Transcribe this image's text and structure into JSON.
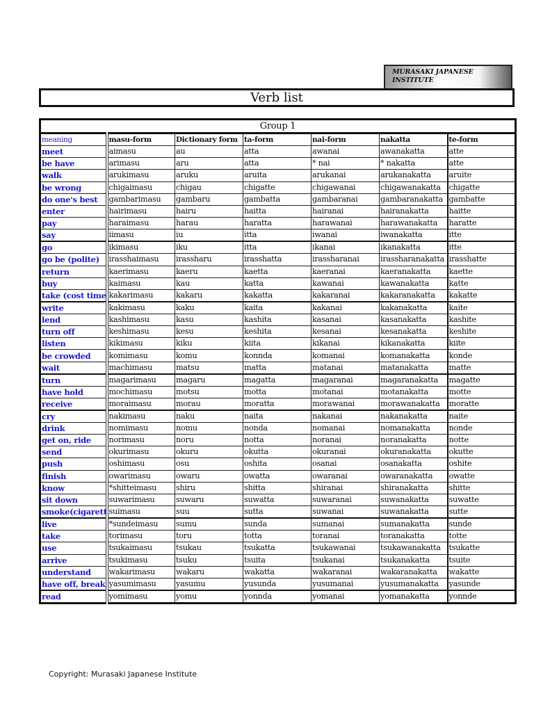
{
  "institute_box": {
    "line1": "MURASAKI JAPANESE",
    "line2": "INSTITUTE"
  },
  "title": "Verb list",
  "group_label": "Group 1",
  "columns": [
    "meaning",
    "masu-form",
    "Dictionary form",
    "ta-form",
    "nai-form",
    "nakatta",
    "te-form"
  ],
  "rows": [
    [
      "meet",
      "aimasu",
      "au",
      "atta",
      "awanai",
      "awanakatta",
      "atte"
    ],
    [
      "be have",
      "arimasu",
      "aru",
      "atta",
      "* nai",
      "* nakatta",
      "atte"
    ],
    [
      "walk",
      "arukimasu",
      "aruku",
      "aruita",
      "arukanai",
      "arukanakatta",
      "aruite"
    ],
    [
      "be wrong",
      "chigaimasu",
      "chigau",
      "chigatte",
      "chigawanai",
      "chigawanakatta",
      "chigatte"
    ],
    [
      "do one's best",
      "gambarimasu",
      "gambaru",
      "gambatta",
      "gambaranai",
      "gambaranakatta",
      "gambatte"
    ],
    [
      "enter",
      "hairimasu",
      "hairu",
      "haitta",
      "hairanai",
      "hairanakatta",
      "haitte"
    ],
    [
      "pay",
      "haraimasu",
      "harau",
      "haratta",
      "harawanai",
      "harawanakatta",
      "haratte"
    ],
    [
      "say",
      "iimasu",
      "iu",
      "itta",
      "iwanai",
      "iwanakatta",
      "itte"
    ],
    [
      "go",
      "ikimasu",
      "iku",
      "itta",
      "ikanai",
      "ikanakatta",
      "itte"
    ],
    [
      "go be (polite)",
      "irasshaimasu",
      "irassharu",
      "irasshatta",
      "irassharanai",
      "irassharanakatta",
      "irasshatte"
    ],
    [
      "return",
      "kaerimasu",
      "kaeru",
      "kaetta",
      "kaeranai",
      "kaeranakatta",
      "kaette"
    ],
    [
      "buy",
      "kaimasu",
      "kau",
      "katta",
      "kawanai",
      "kawanakatta",
      "katte"
    ],
    [
      "take (cost time)",
      "kakarimasu",
      "kakaru",
      "kakatta",
      "kakaranai",
      "kakaranakatta",
      "kakatte"
    ],
    [
      "write",
      "kakimasu",
      "kaku",
      "kaita",
      "kakanai",
      "kakanakatta",
      "kaite"
    ],
    [
      "lend",
      "kashimasu",
      "kasu",
      "kashita",
      "kasanai",
      "kasanakatta",
      "kashite"
    ],
    [
      "turn off",
      "keshimasu",
      "kesu",
      "keshita",
      "kesanai",
      "kesanakatta",
      "keshite"
    ],
    [
      "listen",
      "kikimasu",
      "kiku",
      "kiita",
      "kikanai",
      "kikanakatta",
      "kiite"
    ],
    [
      "be crowded",
      "komimasu",
      "komu",
      "konnda",
      "komanai",
      "komanakatta",
      "konde"
    ],
    [
      "wait",
      "machimasu",
      "matsu",
      "matta",
      "matanai",
      "matanakatta",
      "matte"
    ],
    [
      "turn",
      "magarimasu",
      "magaru",
      "magatta",
      "magaranai",
      "magaranakatta",
      "magatte"
    ],
    [
      "have hold",
      "mochimasu",
      "motsu",
      "motta",
      "motanai",
      "motanakatta",
      "motte"
    ],
    [
      "receive",
      "moraimasu",
      "morau",
      "moratta",
      "morawanai",
      "morawanakatta",
      "moratte"
    ],
    [
      "cry",
      "nakimasu",
      "naku",
      "naita",
      "nakanai",
      "nakanakatta",
      "naite"
    ],
    [
      "drink",
      "nomimasu",
      "nomu",
      "nonda",
      "nomanai",
      "nomanakatta",
      "nonde"
    ],
    [
      "get on, ride",
      "norimasu",
      "noru",
      "notta",
      "noranai",
      "noranakatta",
      "notte"
    ],
    [
      "send",
      "okurimasu",
      "okuru",
      "okutta",
      "okuranai",
      "okuranakatta",
      "okutte"
    ],
    [
      "push",
      "oshimasu",
      "osu",
      "oshita",
      "osanai",
      "osanakatta",
      "oshite"
    ],
    [
      "finish",
      "owarimasu",
      "owaru",
      "owatta",
      "owaranai",
      "owaranakatta",
      "owatte"
    ],
    [
      "know",
      "*shitteimasu",
      "shiru",
      "shitta",
      "shiranai",
      "shiranakatta",
      "shitte"
    ],
    [
      "sit down",
      "suwarimasu",
      "suwaru",
      "suwatta",
      "suwaranai",
      "suwanakatta",
      "suwatte"
    ],
    [
      "smoke(cigarette)",
      "suimasu",
      "suu",
      "sutta",
      "suwanai",
      "suwanakatta",
      "sutte"
    ],
    [
      "live",
      "*sundeimasu",
      "sumu",
      "sunda",
      "sumanai",
      "sumanakatta",
      "sunde"
    ],
    [
      "take",
      "torimasu",
      "toru",
      "totta",
      "toranai",
      "toranakatta",
      "totte"
    ],
    [
      "use",
      "tsukaimasu",
      "tsukau",
      "tsukatta",
      "tsukawanai",
      "tsukawanakatta",
      "tsukatte"
    ],
    [
      "arrive",
      "tsukimasu",
      "tsuku",
      "tsuita",
      "tsukanai",
      "tsukanakatta",
      "tsuite"
    ],
    [
      "understand",
      "wakarimasu",
      "wakaru",
      "wakatta",
      "wakaranai",
      "wakaranakatta",
      "wakatte"
    ],
    [
      "have off, break",
      "yasumimasu",
      "yasumu",
      "yusunda",
      "yusumanai",
      "yusumanakatta",
      "yasunde"
    ],
    [
      "read",
      "yomimasu",
      "yomu",
      "yonnda",
      "yomanai",
      "yomanakatta",
      "yonnde"
    ]
  ],
  "thick_border_before_rows": [
    8,
    13,
    19,
    22,
    31,
    37
  ],
  "colors": {
    "meaning_text": "#1a1acc",
    "border": "#111111"
  },
  "copyright": "Copyright: Murasaki Japanese Institute"
}
